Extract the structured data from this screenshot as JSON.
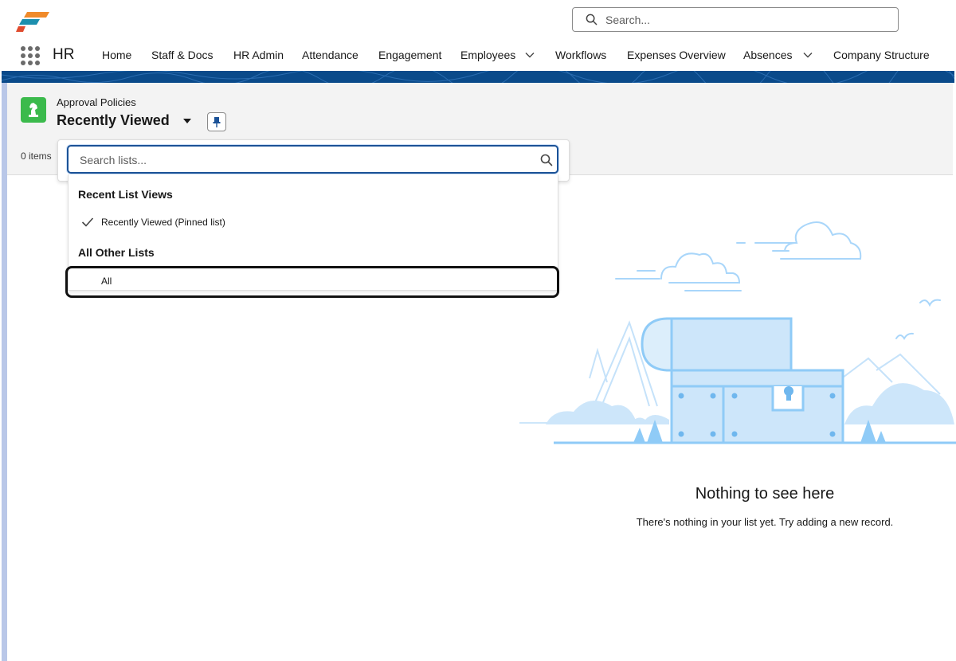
{
  "header": {
    "app_name": "HR",
    "search_placeholder": "Search...",
    "nav": [
      {
        "label": "Home"
      },
      {
        "label": "Staff & Docs"
      },
      {
        "label": "HR Admin"
      },
      {
        "label": "Attendance"
      },
      {
        "label": "Engagement"
      },
      {
        "label": "Employees",
        "has_dropdown": true
      },
      {
        "label": "Workflows"
      },
      {
        "label": "Expenses Overview"
      },
      {
        "label": "Absences",
        "has_dropdown": true
      },
      {
        "label": "Company Structure"
      }
    ]
  },
  "list_header": {
    "object_label": "Approval Policies",
    "view_title": "Recently Viewed",
    "item_count": "0 items"
  },
  "list_picker": {
    "search_placeholder": "Search lists...",
    "sections": [
      {
        "heading": "Recent List Views",
        "options": [
          {
            "label": "Recently Viewed (Pinned list)",
            "selected": true
          }
        ]
      },
      {
        "heading": "All Other Lists",
        "options": [
          {
            "label": "All",
            "selected": false
          }
        ]
      }
    ]
  },
  "empty_state": {
    "title": "Nothing to see here",
    "subtitle": "There's nothing in your list yet. Try adding a new record."
  },
  "colors": {
    "accent_blue": "#1b5297",
    "object_icon_green": "#3bba4c",
    "illustration_blue": "#cde6fa",
    "illustration_stroke": "#8fcbf7"
  }
}
